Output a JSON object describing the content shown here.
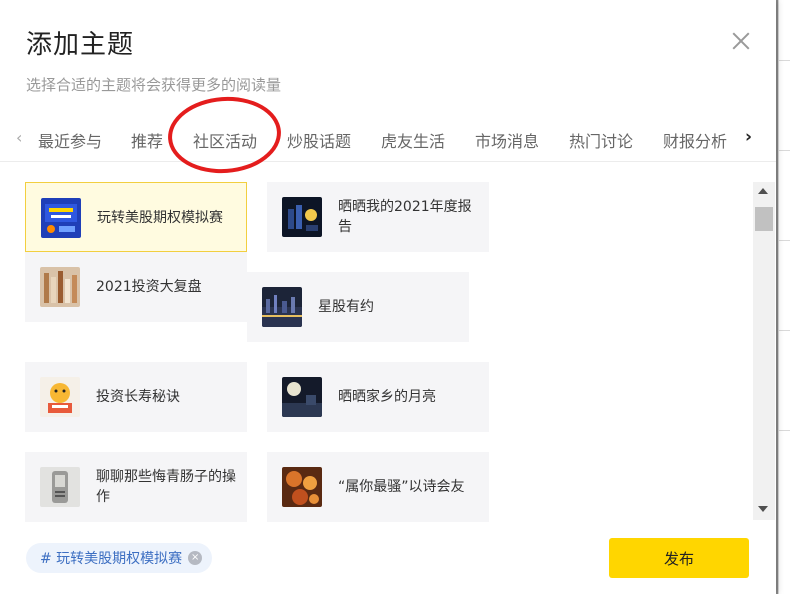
{
  "modal": {
    "title": "添加主题",
    "subtitle": "选择合适的主题将会获得更多的阅读量"
  },
  "tabs": [
    {
      "label": "最近参与",
      "active": false
    },
    {
      "label": "推荐",
      "active": false
    },
    {
      "label": "社区活动",
      "active": true
    },
    {
      "label": "炒股话题",
      "active": false
    },
    {
      "label": "虎友生活",
      "active": false
    },
    {
      "label": "市场消息",
      "active": false
    },
    {
      "label": "热门讨论",
      "active": false
    },
    {
      "label": "财报分析",
      "active": false
    }
  ],
  "topics": [
    {
      "label": "玩转美股期权模拟赛",
      "selected": true,
      "icon": "option-contest-thumbnail"
    },
    {
      "label": "晒晒我的2021年度报告",
      "selected": false,
      "icon": "annual-report-thumbnail"
    },
    {
      "label": "2021投资大复盘",
      "selected": false,
      "icon": "investment-review-thumbnail"
    },
    {
      "label": "星股有约",
      "selected": false,
      "icon": "city-night-thumbnail"
    },
    {
      "label": "投资长寿秘诀",
      "selected": false,
      "icon": "tiger-mascot-thumbnail"
    },
    {
      "label": "晒晒家乡的月亮",
      "selected": false,
      "icon": "moon-thumbnail"
    },
    {
      "label": "聊聊那些悔青肠子的操作",
      "selected": false,
      "icon": "gadget-thumbnail"
    },
    {
      "label": "“属你最骚”以诗会友",
      "selected": false,
      "icon": "autumn-leaves-thumbnail"
    }
  ],
  "selected_chip": {
    "label": "# 玩转美股期权模拟赛",
    "remove_glyph": "×"
  },
  "publish_label": "发布",
  "colors": {
    "accent_yellow": "#ffd600",
    "annotation_red": "#e41d1d",
    "chip_text_blue": "#3d6fc2"
  }
}
